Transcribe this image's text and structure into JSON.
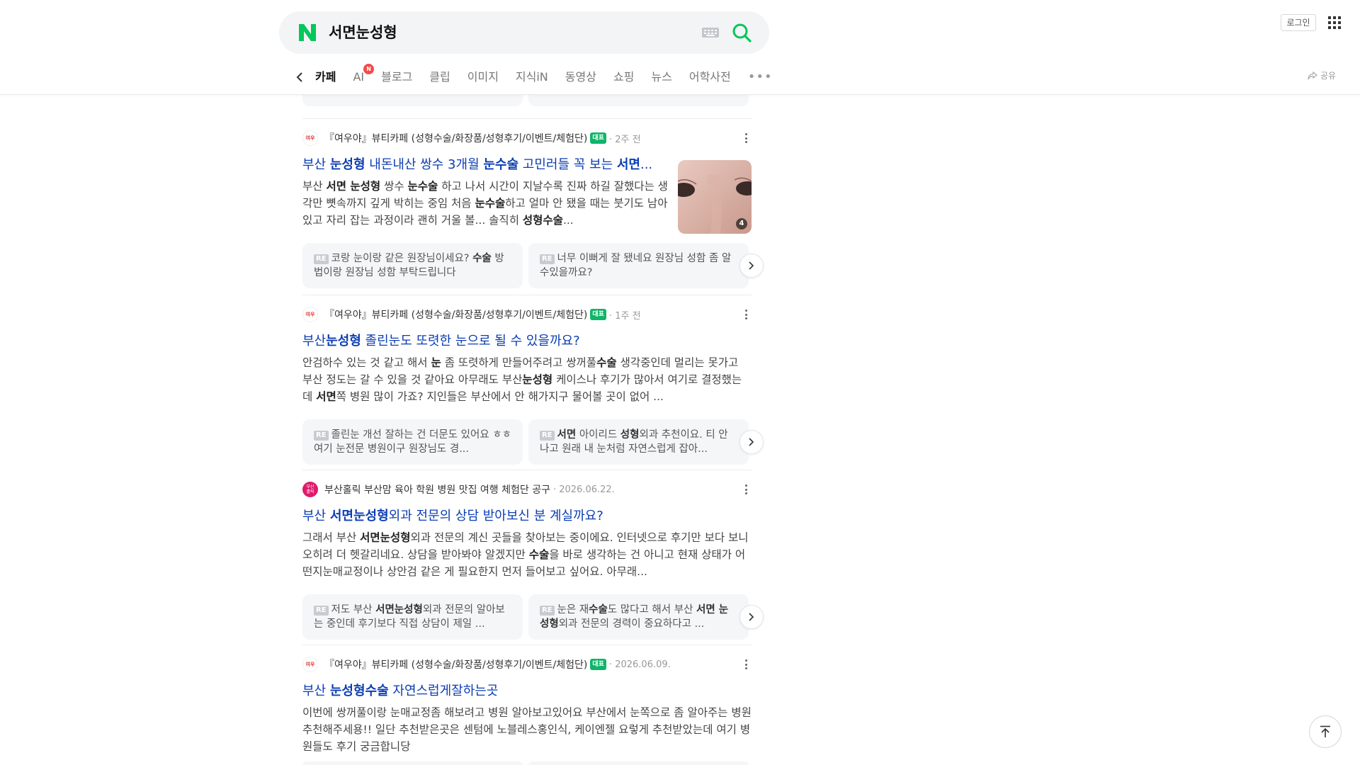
{
  "search": {
    "query": "서면눈성형"
  },
  "header": {
    "login_label": "로그인",
    "share_label": "공유"
  },
  "tabs": [
    {
      "label": "카페",
      "active": true
    },
    {
      "label": "AI",
      "badge": "N"
    },
    {
      "label": "블로그"
    },
    {
      "label": "클립"
    },
    {
      "label": "이미지"
    },
    {
      "label": "지식iN"
    },
    {
      "label": "동영상"
    },
    {
      "label": "쇼핑"
    },
    {
      "label": "뉴스"
    },
    {
      "label": "어학사전"
    }
  ],
  "results": [
    {
      "source": "『여우야』뷰티카페 (성형수술/화장품/성형후기/이벤트/체험단)",
      "badge": "대표",
      "time": "· 2주 전",
      "title_html": "부산 <b>눈성형</b> 내돈내산 쌍수 3개월 <b>눈수술</b> 고민러들 꼭 보는 <b>서면</b>...",
      "desc_html": "부산 <b>서면 눈성형</b> 쌍수 <b>눈수술</b> 하고 나서 시간이 지날수록 진짜 하길 잘했다는 생각만 뼛속까지 깊게 박히는 중임 처음 <b>눈수술</b>하고 얼마 안 됐을 때는 붓기도 남아 있고 자리 잡는 과정이라 괜히 거울 볼... 솔직히 <b>성형수술</b>...",
      "thumb_count": "4",
      "replies_html": [
        "<span class=\"re\">RE</span>코랑 눈이랑 같은 원장님이세요? <b>수술</b> 방법이랑 원장님 성함 부탁드립니다",
        "<span class=\"re\">RE</span>너무 이뻐게 잘 됐네요 원장님 성함 좀 알수있을까요?"
      ]
    },
    {
      "source": "『여우야』뷰티카페 (성형수술/화장품/성형후기/이벤트/체험단)",
      "badge": "대표",
      "time": "· 1주 전",
      "title_html": "부산<b>눈성형</b> 졸린눈도 또렷한 눈으로 될 수 있을까요?",
      "desc_html": "안검하수 있는 것 같고 해서 <b>눈</b> 좀 또렷하게 만들어주려고 쌍꺼풀<b>수술</b> 생각중인데 멀리는 못가고 부산 정도는 갈 수 있을 것 같아요 아무래도 부산<b>눈성형</b> 케이스나 후기가 많아서 여기로 결정했는데 <b>서면</b>쪽 병원 많이 가죠? 지인들은 부산에서 안 해가지구 물어볼 곳이 없어 ...",
      "replies_html": [
        "<span class=\"re\">RE</span>졸린눈 개선 잘하는 건 더문도 있어요 ㅎㅎ 여기 눈전문 병원이구 원장님도 경...",
        "<span class=\"re\">RE</span><b>서면</b> 아이리드 <b>성형</b>외과 추천이요. 티 안 나고 원래 내 눈처럼 자연스럽게 잡아..."
      ]
    },
    {
      "source": "부산홀릭 부산맘 육아 학원 병원 맛집 여행 체험단 공구",
      "time": "· 2026.06.22.",
      "title_html": "부산 <b>서면눈성형</b>외과 전문의 상담 받아보신 분 계실까요?",
      "desc_html": "그래서 부산 <b>서면눈성형</b>외과 전문의 계신 곳들을 찾아보는 중이에요. 인터넷으로 후기만 보다 보니 오히려 더 헷갈리네요. 상담을 받아봐야 알겠지만 <b>수술</b>을 바로 생각하는 건 아니고 현재 상태가 어떤지눈매교정이나 상안검 같은 게 필요한지 먼저 들어보고 싶어요. 아무래...",
      "replies_html": [
        "<span class=\"re\">RE</span>저도 부산 <b>서면눈성형</b>외과 전문의 알아보는 중인데 후기보다 직접 상담이 제일 ...",
        "<span class=\"re\">RE</span>눈은 재<b>수술</b>도 많다고 해서 부산 <b>서면 눈성형</b>외과 전문의 경력이 중요하다고 ..."
      ]
    },
    {
      "source": "『여우야』뷰티카페 (성형수술/화장품/성형후기/이벤트/체험단)",
      "badge": "대표",
      "time": "· 2026.06.09.",
      "title_html": "부산 <b>눈성형수술</b> 자연스럽게잘하는곳",
      "desc_html": "이번에 쌍꺼풀이랑 눈매교정좀 해보려고 병원 알아보고있어요 부산에서 눈쪽으로 좀 알아주는 병원 추천해주세용!! 일단 추천받은곳은 센텀에 노블레스홍인식, 케이엔젤 요렇게 추천받았는데 여기 병원들도 후기 궁금합니당"
    }
  ]
}
